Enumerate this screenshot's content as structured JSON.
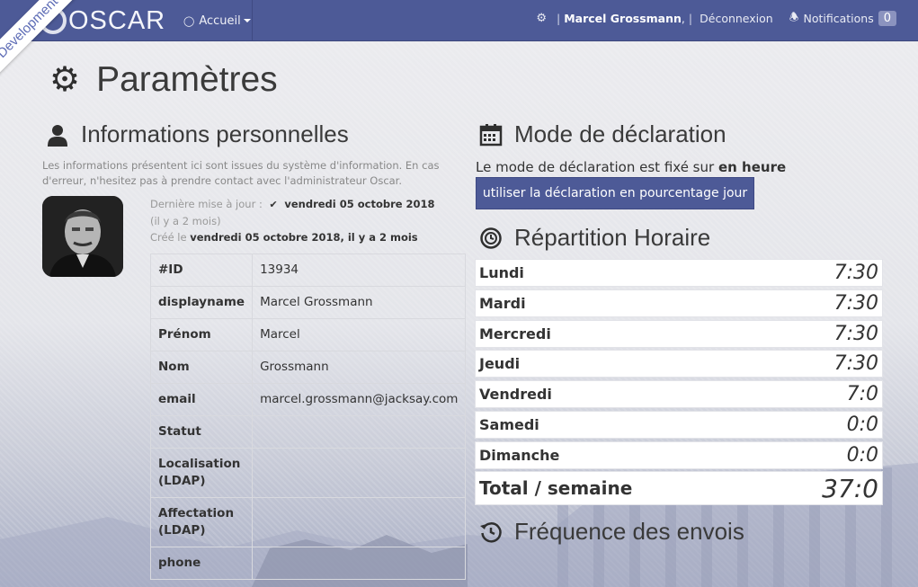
{
  "ribbon": "Development",
  "nav": {
    "brand": "OSCAR",
    "accueil": "Accueil",
    "user": "Marcel Grossmann",
    "logout": "Déconnexion",
    "notifications": "Notifications",
    "notif_count": "0"
  },
  "page": {
    "title": "Paramètres"
  },
  "personal": {
    "title": "Informations personnelles",
    "info": "Les informations présentent ici sont issues du système d'information. En cas d'erreur, n'hesitez pas à prendre contact avec l'administrateur Oscar.",
    "updated_label": "Dernière mise à jour :",
    "updated_date": "vendredi 05 octobre 2018",
    "updated_rel": "(il y a 2 mois)",
    "created_label": "Créé le",
    "created_value": "vendredi 05 octobre 2018, il y a 2 mois",
    "rows": [
      {
        "k": "#ID",
        "v": "13934"
      },
      {
        "k": "displayname",
        "v": "Marcel Grossmann"
      },
      {
        "k": "Prénom",
        "v": "Marcel"
      },
      {
        "k": "Nom",
        "v": "Grossmann"
      },
      {
        "k": "email",
        "v": "marcel.grossmann@jacksay.com"
      },
      {
        "k": "Statut",
        "v": ""
      },
      {
        "k": "Localisation (LDAP)",
        "v": ""
      },
      {
        "k": "Affectation (LDAP)",
        "v": ""
      },
      {
        "k": "phone",
        "v": ""
      }
    ]
  },
  "mode": {
    "title": "Mode de déclaration",
    "text_prefix": "Le mode de déclaration est fixé sur",
    "text_value": "en heure",
    "button": "utiliser la déclaration en pourcentage jour"
  },
  "repartition": {
    "title": "Répartition Horaire",
    "days": [
      {
        "d": "Lundi",
        "h": "7:30"
      },
      {
        "d": "Mardi",
        "h": "7:30"
      },
      {
        "d": "Mercredi",
        "h": "7:30"
      },
      {
        "d": "Jeudi",
        "h": "7:30"
      },
      {
        "d": "Vendredi",
        "h": "7:0"
      },
      {
        "d": "Samedi",
        "h": "0:0"
      },
      {
        "d": "Dimanche",
        "h": "0:0"
      }
    ],
    "total_label": "Total / semaine",
    "total_value": "37:0"
  },
  "frequence": {
    "title": "Fréquence des envois"
  }
}
